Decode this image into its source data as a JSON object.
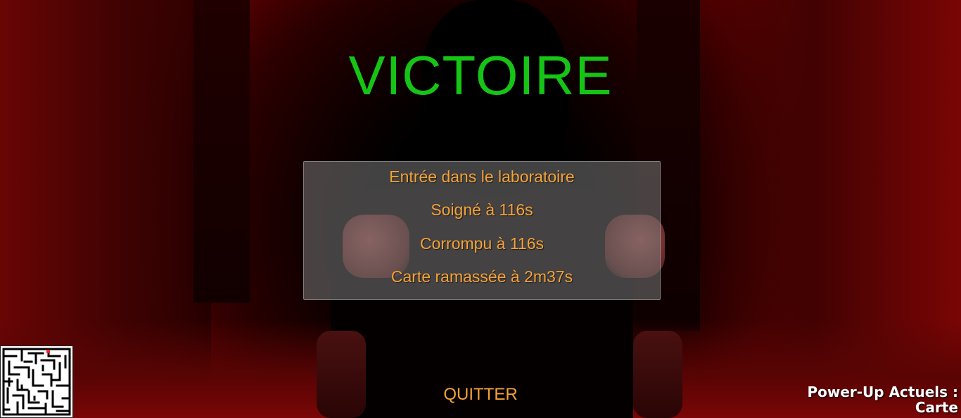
{
  "title": "VICTOIRE",
  "log": [
    "Entrée dans le laboratoire",
    "Soigné à 116s",
    "Corrompu à 116s",
    "Carte ramassée à 2m37s"
  ],
  "quit_label": "QUITTER",
  "powerup": {
    "label": "Power-Up Actuels :",
    "value": "Carte"
  },
  "minimap_icon": "maze-minimap",
  "colors": {
    "title": "#16c416",
    "log_text": "#f4a23a",
    "panel": "#787878",
    "minimap_marker": "#ff2020"
  }
}
